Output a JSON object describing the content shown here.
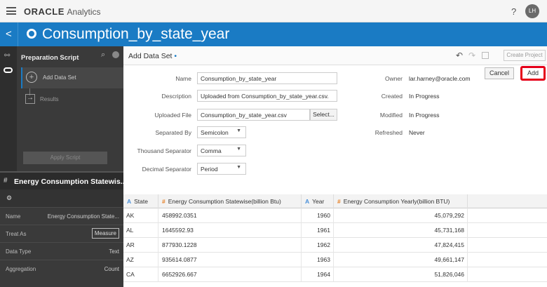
{
  "app": {
    "brand": "ORACLE",
    "product": "Analytics",
    "help": "?",
    "user_initials": "LH"
  },
  "titlebar": {
    "back": "<",
    "title": "Consumption_by_state_year"
  },
  "script_panel": {
    "title": "Preparation Script",
    "steps": [
      {
        "label": "Add Data Set"
      },
      {
        "label": "Results"
      }
    ],
    "apply_label": "Apply Script"
  },
  "column_panel": {
    "title": "Energy Consumption Statewis...",
    "props": [
      {
        "key": "Name",
        "value": "Energy Consumption State..."
      },
      {
        "key": "Treat As",
        "value": "Measure"
      },
      {
        "key": "Data Type",
        "value": "Text"
      },
      {
        "key": "Aggregation",
        "value": "Count"
      }
    ]
  },
  "subbar": {
    "title": "Add Data Set",
    "create_project": "Create Project"
  },
  "form": {
    "name_label": "Name",
    "name_value": "Consumption_by_state_year",
    "description_label": "Description",
    "description_value": "Uploaded from Consumption_by_state_year.csv.",
    "file_label": "Uploaded File",
    "file_value": "Consumption_by_state_year.csv",
    "select_label": "Select...",
    "separated_label": "Separated By",
    "separated_value": "Semicolon",
    "thousand_label": "Thousand Separator",
    "thousand_value": "Comma",
    "decimal_label": "Decimal Separator",
    "decimal_value": "Period"
  },
  "meta": {
    "owner_label": "Owner",
    "owner_value": "lar.harney@oracle.com",
    "created_label": "Created",
    "created_value": "In Progress",
    "modified_label": "Modified",
    "modified_value": "In Progress",
    "refreshed_label": "Refreshed",
    "refreshed_value": "Never"
  },
  "actions": {
    "cancel": "Cancel",
    "add": "Add"
  },
  "table": {
    "columns": [
      {
        "label": "State",
        "type": "text"
      },
      {
        "label": "Energy Consumption Statewise(billion Btu)",
        "type": "number"
      },
      {
        "label": "Year",
        "type": "text"
      },
      {
        "label": "Energy Consumption Yearly(billion BTU)",
        "type": "number"
      }
    ],
    "rows": [
      [
        "AK",
        "458992.0351",
        "1960",
        "45,079,292"
      ],
      [
        "AL",
        "1645592.93",
        "1961",
        "45,731,168"
      ],
      [
        "AR",
        "877930.1228",
        "1962",
        "47,824,415"
      ],
      [
        "AZ",
        "935614.0877",
        "1963",
        "49,661,147"
      ],
      [
        "CA",
        "6652926.667",
        "1964",
        "51,826,046"
      ]
    ]
  },
  "colors": {
    "accent": "#1a7bc4",
    "highlight": "#e5001a",
    "panel_dark": "#3a3a3a"
  }
}
